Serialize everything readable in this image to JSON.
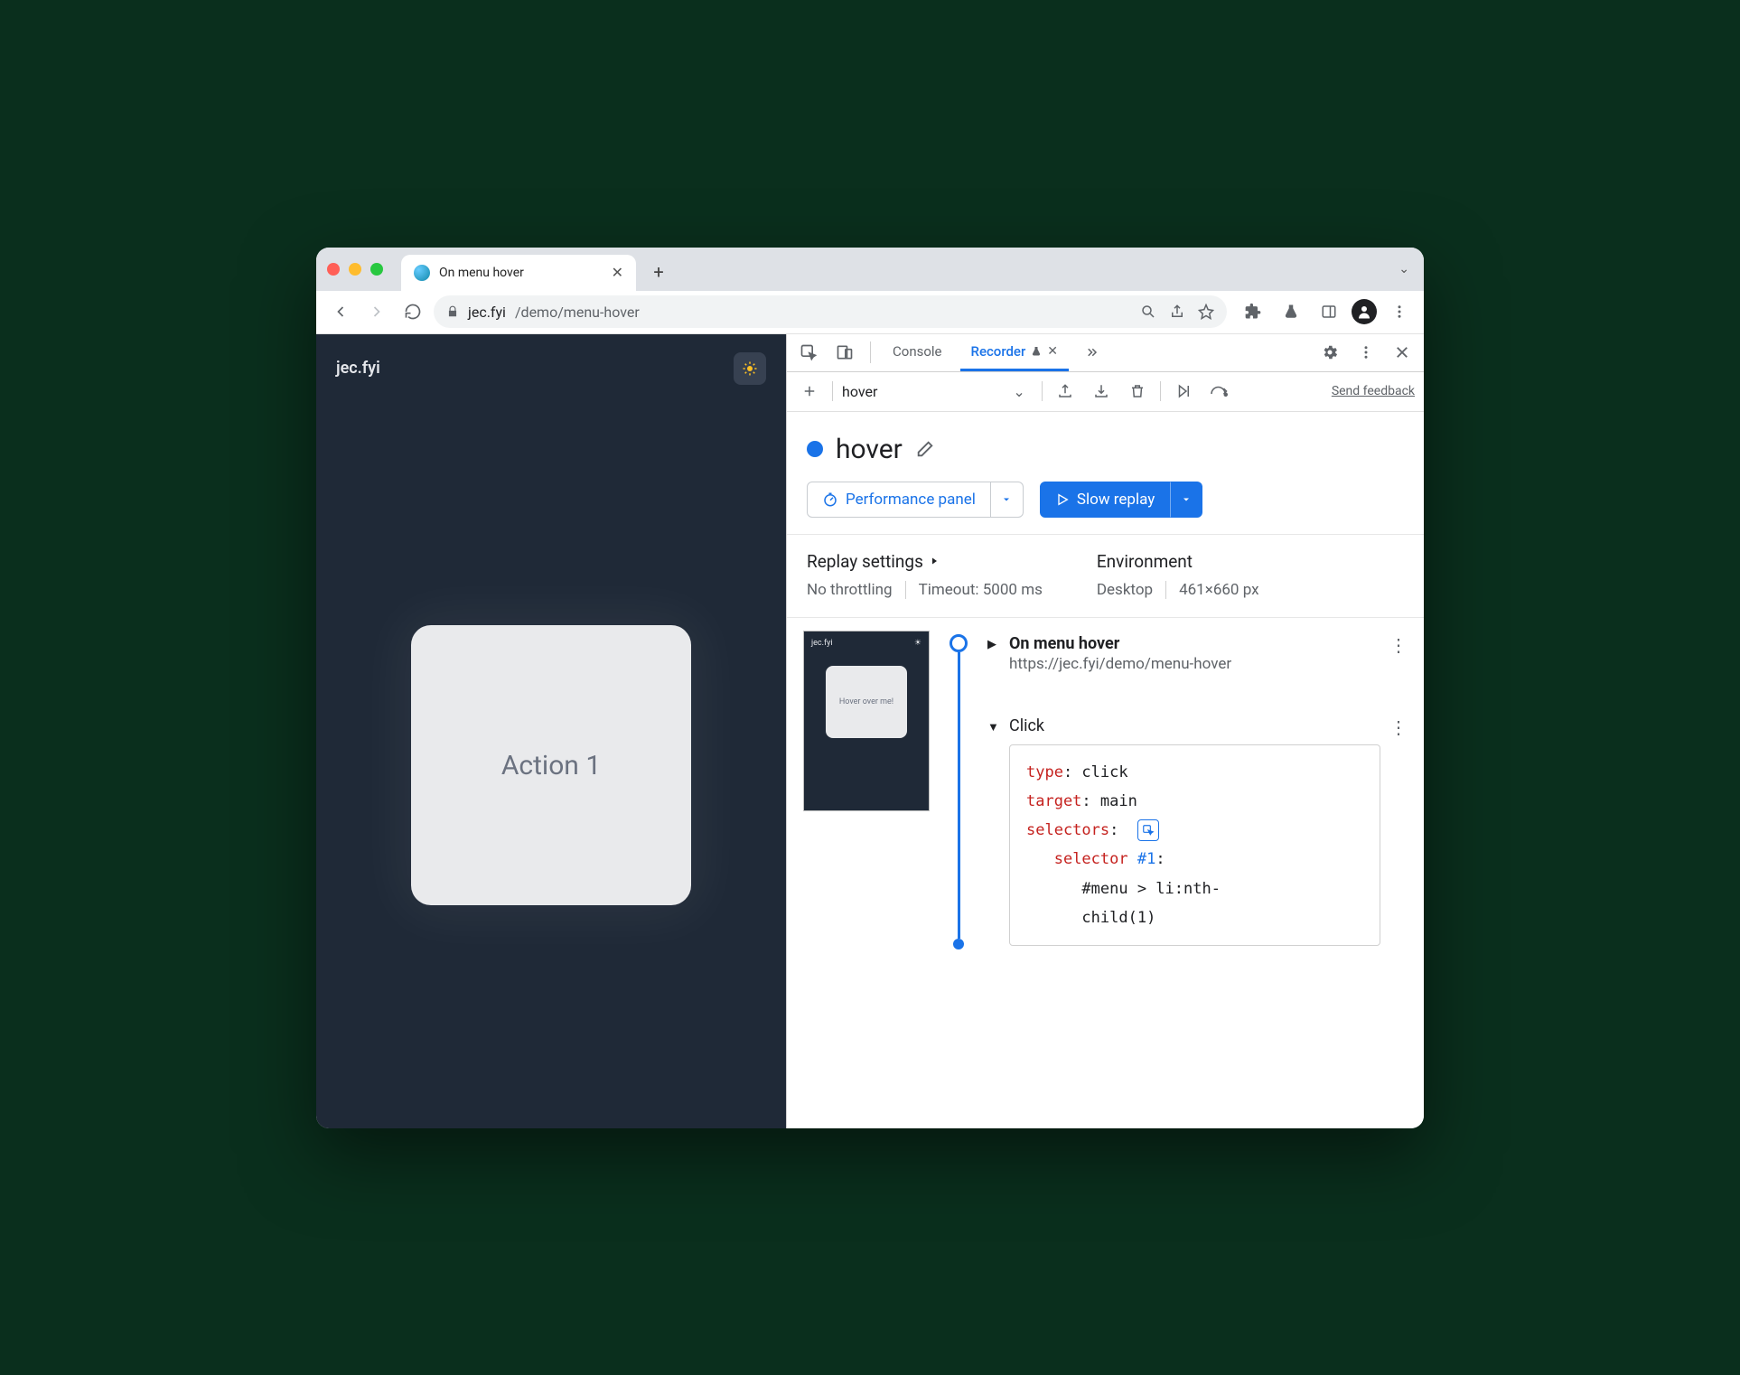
{
  "browser": {
    "tab_title": "On menu hover",
    "url_domain": "jec.fyi",
    "url_path": "/demo/menu-hover"
  },
  "page": {
    "brand": "jec.fyi",
    "card_label": "Action 1"
  },
  "devtools": {
    "tabs": {
      "console": "Console",
      "recorder": "Recorder"
    },
    "recorder_toolbar": {
      "selected_recording": "hover",
      "feedback_link": "Send feedback"
    },
    "recording": {
      "title": "hover",
      "performance_button": "Performance panel",
      "replay_button": "Slow replay"
    },
    "settings": {
      "replay_heading": "Replay settings",
      "throttling": "No throttling",
      "timeout": "Timeout: 5000 ms",
      "env_heading": "Environment",
      "device": "Desktop",
      "viewport": "461×660 px"
    },
    "thumbnail": {
      "brand": "jec.fyi",
      "card": "Hover over me!"
    },
    "steps": {
      "nav": {
        "title": "On menu hover",
        "url": "https://jec.fyi/demo/menu-hover"
      },
      "click": {
        "title": "Click",
        "code": {
          "type_k": "type",
          "type_v": ": click",
          "target_k": "target",
          "target_v": ": main",
          "selectors_k": "selectors",
          "selectors_v": ":",
          "selector_k": "selector ",
          "selector_i": "#1",
          "selector_v": ":",
          "sel_line1": "#menu > li:nth-",
          "sel_line2": "child(1)"
        }
      }
    }
  }
}
